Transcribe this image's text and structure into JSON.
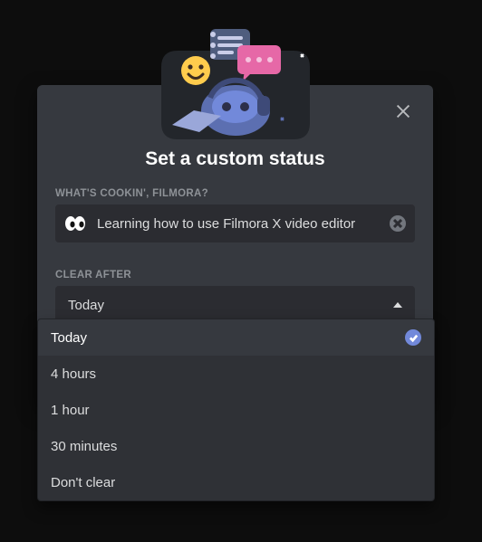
{
  "modal": {
    "title": "Set a custom status",
    "prompt_label": "WHAT'S COOKIN', FILMORA?",
    "status_value": "Learning how to use Filmora X video editor",
    "emoji_name": "eyes",
    "clear_after_label": "CLEAR AFTER",
    "clear_after_selected": "Today"
  },
  "clear_options": [
    {
      "label": "Today",
      "selected": true
    },
    {
      "label": "4 hours",
      "selected": false
    },
    {
      "label": "1 hour",
      "selected": false
    },
    {
      "label": "30 minutes",
      "selected": false
    },
    {
      "label": "Don't clear",
      "selected": false
    }
  ],
  "icons": {
    "close": "close-icon",
    "clear_input": "clear-input-icon",
    "dropdown_caret": "caret-up-icon",
    "check": "check-icon"
  },
  "colors": {
    "modal_bg": "#36393f",
    "footer_bg": "#2f3136",
    "input_bg": "#2b2c31",
    "accent": "#7289da"
  }
}
